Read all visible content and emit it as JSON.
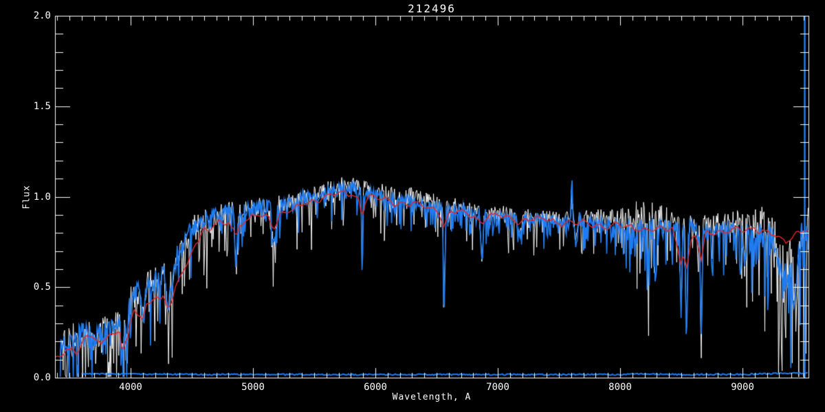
{
  "title": "212496",
  "axes": {
    "x": {
      "label": "Wavelength, A",
      "range": [
        3382,
        9539
      ],
      "major_ticks": [
        4000,
        5000,
        6000,
        7000,
        8000,
        9000
      ],
      "tick_labels": [
        "4000",
        "5000",
        "6000",
        "7000",
        "8000",
        "9000"
      ],
      "minor_tick_interval": 100
    },
    "y": {
      "label": "Flux",
      "range": [
        0,
        2
      ],
      "major_ticks": [
        0.0,
        0.5,
        1.0,
        1.5,
        2.0
      ],
      "tick_labels": [
        "0.0",
        "0.5",
        "1.0",
        "1.5",
        "2.0"
      ],
      "minor_tick_interval": 0.1
    }
  },
  "colors": {
    "background": "#000000",
    "axis": "#ffffff",
    "observed_spectrum_white": "#ffffff",
    "observed_spectrum_blue": "#1f7cf0",
    "model_fit_red": "#e22828"
  },
  "chart_data": {
    "type": "line",
    "title": "212496",
    "xlabel": "Wavelength, A",
    "ylabel": "Flux",
    "xlim": [
      3382,
      9539
    ],
    "ylim": [
      0,
      2
    ],
    "grid": false,
    "legend": "none",
    "start_wavelength_observed": 3425,
    "start_wavelength_error": 3600,
    "error_level": 0.013,
    "edge_line_wavelength": 9506,
    "continuum": [
      [
        3390,
        0.17
      ],
      [
        3500,
        0.21
      ],
      [
        3600,
        0.24
      ],
      [
        3700,
        0.22
      ],
      [
        3800,
        0.26
      ],
      [
        3900,
        0.3
      ],
      [
        4000,
        0.44
      ],
      [
        4100,
        0.5
      ],
      [
        4200,
        0.54
      ],
      [
        4300,
        0.6
      ],
      [
        4400,
        0.7
      ],
      [
        4500,
        0.84
      ],
      [
        4600,
        0.88
      ],
      [
        4700,
        0.9
      ],
      [
        4800,
        0.92
      ],
      [
        4900,
        0.92
      ],
      [
        5000,
        0.93
      ],
      [
        5100,
        0.95
      ],
      [
        5200,
        0.95
      ],
      [
        5300,
        0.96
      ],
      [
        5400,
        0.99
      ],
      [
        5500,
        1.01
      ],
      [
        5600,
        1.02
      ],
      [
        5700,
        1.04
      ],
      [
        5800,
        1.05
      ],
      [
        5900,
        1.03
      ],
      [
        6000,
        1.01
      ],
      [
        6100,
        1.0
      ],
      [
        6200,
        0.99
      ],
      [
        6300,
        0.98
      ],
      [
        6400,
        0.96
      ],
      [
        6500,
        0.95
      ],
      [
        6600,
        0.94
      ],
      [
        6700,
        0.93
      ],
      [
        6800,
        0.92
      ],
      [
        6900,
        0.91
      ],
      [
        7000,
        0.9
      ],
      [
        7100,
        0.9
      ],
      [
        7200,
        0.89
      ],
      [
        7300,
        0.88
      ],
      [
        7400,
        0.88
      ],
      [
        7500,
        0.87
      ],
      [
        7600,
        0.87
      ],
      [
        7700,
        0.86
      ],
      [
        7800,
        0.86
      ],
      [
        7900,
        0.85
      ],
      [
        8000,
        0.85
      ],
      [
        8100,
        0.83
      ],
      [
        8200,
        0.82
      ],
      [
        8300,
        0.82
      ],
      [
        8400,
        0.83
      ],
      [
        8500,
        0.83
      ],
      [
        8600,
        0.83
      ],
      [
        8700,
        0.82
      ],
      [
        8800,
        0.82
      ],
      [
        8900,
        0.81
      ],
      [
        9000,
        0.81
      ],
      [
        9100,
        0.8
      ],
      [
        9200,
        0.8
      ],
      [
        9300,
        0.79
      ],
      [
        9400,
        0.79
      ],
      [
        9500,
        0.8
      ],
      [
        9539,
        0.8
      ]
    ],
    "features": [
      [
        3934,
        0.22,
        12
      ],
      [
        3969,
        0.18,
        10
      ],
      [
        4102,
        0.18,
        9
      ],
      [
        4305,
        0.22,
        14
      ],
      [
        4340,
        0.15,
        8
      ],
      [
        4861,
        0.3,
        9
      ],
      [
        5175,
        0.22,
        13
      ],
      [
        5892,
        0.44,
        5
      ],
      [
        6563,
        0.48,
        7
      ],
      [
        6870,
        0.28,
        9
      ],
      [
        7180,
        0.1,
        18
      ],
      [
        7605,
        -0.28,
        5
      ],
      [
        7640,
        0.12,
        10
      ],
      [
        8227,
        0.1,
        8
      ],
      [
        8498,
        0.52,
        6
      ],
      [
        8542,
        0.6,
        7
      ],
      [
        8662,
        0.55,
        7
      ],
      [
        8750,
        0.25,
        5
      ],
      [
        9015,
        0.2,
        8
      ],
      [
        9345,
        0.22,
        55
      ],
      [
        9430,
        0.3,
        18
      ]
    ],
    "noise_sigma": [
      [
        3390,
        0.085
      ],
      [
        3600,
        0.085
      ],
      [
        3800,
        0.08
      ],
      [
        4000,
        0.075
      ],
      [
        4200,
        0.07
      ],
      [
        4400,
        0.06
      ],
      [
        4700,
        0.052
      ],
      [
        5000,
        0.05
      ],
      [
        5300,
        0.048
      ],
      [
        5600,
        0.045
      ],
      [
        6000,
        0.042
      ],
      [
        6400,
        0.042
      ],
      [
        6800,
        0.038
      ],
      [
        7200,
        0.032
      ],
      [
        7600,
        0.035
      ],
      [
        8000,
        0.04
      ],
      [
        8120,
        0.075
      ],
      [
        8250,
        0.085
      ],
      [
        8380,
        0.06
      ],
      [
        8500,
        0.05
      ],
      [
        8700,
        0.045
      ],
      [
        8900,
        0.055
      ],
      [
        9050,
        0.07
      ],
      [
        9200,
        0.1
      ],
      [
        9350,
        0.12
      ],
      [
        9450,
        0.13
      ],
      [
        9539,
        0.12
      ]
    ],
    "white_offset": [
      [
        3390,
        0.0
      ],
      [
        4500,
        0.0
      ],
      [
        5000,
        0.005
      ],
      [
        5500,
        0.01
      ],
      [
        5800,
        0.025
      ],
      [
        6200,
        0.03
      ],
      [
        6600,
        0.025
      ],
      [
        7000,
        0.015
      ],
      [
        7400,
        0.01
      ],
      [
        7800,
        0.03
      ],
      [
        8000,
        0.055
      ],
      [
        8200,
        0.075
      ],
      [
        8400,
        0.06
      ],
      [
        8600,
        0.02
      ],
      [
        8800,
        0.045
      ],
      [
        9000,
        0.055
      ],
      [
        9200,
        0.05
      ],
      [
        9350,
        0.04
      ],
      [
        9539,
        0.03
      ]
    ],
    "model": [
      [
        3390,
        0.1
      ],
      [
        3440,
        0.13
      ],
      [
        3470,
        0.16
      ],
      [
        3500,
        0.15
      ],
      [
        3530,
        0.18
      ],
      [
        3560,
        0.14
      ],
      [
        3600,
        0.19
      ],
      [
        3640,
        0.22
      ],
      [
        3680,
        0.24
      ],
      [
        3720,
        0.2
      ],
      [
        3750,
        0.17
      ],
      [
        3790,
        0.22
      ],
      [
        3830,
        0.26
      ],
      [
        3870,
        0.24
      ],
      [
        3910,
        0.26
      ],
      [
        3935,
        0.14
      ],
      [
        3955,
        0.22
      ],
      [
        3970,
        0.17
      ],
      [
        4000,
        0.3
      ],
      [
        4030,
        0.37
      ],
      [
        4060,
        0.35
      ],
      [
        4100,
        0.31
      ],
      [
        4130,
        0.4
      ],
      [
        4170,
        0.44
      ],
      [
        4200,
        0.46
      ],
      [
        4240,
        0.42
      ],
      [
        4270,
        0.46
      ],
      [
        4305,
        0.38
      ],
      [
        4340,
        0.41
      ],
      [
        4370,
        0.5
      ],
      [
        4400,
        0.55
      ],
      [
        4430,
        0.6
      ],
      [
        4470,
        0.64
      ],
      [
        4500,
        0.7
      ],
      [
        4530,
        0.75
      ],
      [
        4570,
        0.79
      ],
      [
        4600,
        0.82
      ],
      [
        4640,
        0.8
      ],
      [
        4680,
        0.84
      ],
      [
        4720,
        0.86
      ],
      [
        4760,
        0.84
      ],
      [
        4800,
        0.87
      ],
      [
        4830,
        0.84
      ],
      [
        4861,
        0.77
      ],
      [
        4890,
        0.85
      ],
      [
        4930,
        0.87
      ],
      [
        4970,
        0.86
      ],
      [
        5000,
        0.89
      ],
      [
        5040,
        0.9
      ],
      [
        5080,
        0.88
      ],
      [
        5120,
        0.89
      ],
      [
        5175,
        0.84
      ],
      [
        5220,
        0.9
      ],
      [
        5260,
        0.92
      ],
      [
        5300,
        0.93
      ],
      [
        5340,
        0.92
      ],
      [
        5380,
        0.95
      ],
      [
        5420,
        0.96
      ],
      [
        5460,
        0.97
      ],
      [
        5500,
        0.98
      ],
      [
        5540,
        0.99
      ],
      [
        5580,
        1.0
      ],
      [
        5620,
        1.0
      ],
      [
        5660,
        1.01
      ],
      [
        5700,
        1.01
      ],
      [
        5740,
        1.02
      ],
      [
        5780,
        1.02
      ],
      [
        5820,
        1.01
      ],
      [
        5860,
        1.0
      ],
      [
        5892,
        0.9
      ],
      [
        5920,
        0.99
      ],
      [
        5960,
        1.0
      ],
      [
        6000,
        0.99
      ],
      [
        6050,
        0.98
      ],
      [
        6100,
        0.98
      ],
      [
        6150,
        0.97
      ],
      [
        6200,
        0.97
      ],
      [
        6250,
        0.96
      ],
      [
        6300,
        0.96
      ],
      [
        6350,
        0.95
      ],
      [
        6400,
        0.94
      ],
      [
        6450,
        0.94
      ],
      [
        6500,
        0.93
      ],
      [
        6530,
        0.91
      ],
      [
        6563,
        0.83
      ],
      [
        6600,
        0.91
      ],
      [
        6650,
        0.92
      ],
      [
        6700,
        0.91
      ],
      [
        6750,
        0.91
      ],
      [
        6800,
        0.9
      ],
      [
        6870,
        0.86
      ],
      [
        6920,
        0.9
      ],
      [
        6970,
        0.89
      ],
      [
        7020,
        0.89
      ],
      [
        7070,
        0.88
      ],
      [
        7120,
        0.88
      ],
      [
        7180,
        0.86
      ],
      [
        7230,
        0.88
      ],
      [
        7280,
        0.88
      ],
      [
        7330,
        0.87
      ],
      [
        7380,
        0.87
      ],
      [
        7430,
        0.87
      ],
      [
        7480,
        0.86
      ],
      [
        7530,
        0.86
      ],
      [
        7580,
        0.86
      ],
      [
        7630,
        0.85
      ],
      [
        7680,
        0.85
      ],
      [
        7730,
        0.85
      ],
      [
        7780,
        0.85
      ],
      [
        7830,
        0.84
      ],
      [
        7880,
        0.84
      ],
      [
        7930,
        0.84
      ],
      [
        7980,
        0.84
      ],
      [
        8030,
        0.83
      ],
      [
        8080,
        0.83
      ],
      [
        8150,
        0.83
      ],
      [
        8220,
        0.82
      ],
      [
        8290,
        0.82
      ],
      [
        8360,
        0.82
      ],
      [
        8430,
        0.82
      ],
      [
        8498,
        0.63
      ],
      [
        8520,
        0.72
      ],
      [
        8542,
        0.6
      ],
      [
        8580,
        0.76
      ],
      [
        8620,
        0.8
      ],
      [
        8662,
        0.63
      ],
      [
        8700,
        0.79
      ],
      [
        8750,
        0.8
      ],
      [
        8800,
        0.81
      ],
      [
        8850,
        0.81
      ],
      [
        8900,
        0.82
      ],
      [
        8950,
        0.82
      ],
      [
        9000,
        0.81
      ],
      [
        9050,
        0.81
      ],
      [
        9100,
        0.82
      ],
      [
        9150,
        0.82
      ],
      [
        9200,
        0.81
      ],
      [
        9250,
        0.8
      ],
      [
        9300,
        0.77
      ],
      [
        9350,
        0.74
      ],
      [
        9400,
        0.77
      ],
      [
        9450,
        0.81
      ],
      [
        9500,
        0.82
      ],
      [
        9539,
        0.82
      ]
    ],
    "series": [
      {
        "name": "observed-spectrum-white",
        "color": "#ffffff"
      },
      {
        "name": "observed-spectrum-blue",
        "color": "#1f7cf0"
      },
      {
        "name": "error-spectrum-blue",
        "color": "#1f7cf0"
      },
      {
        "name": "model-fit-red",
        "color": "#e22828"
      },
      {
        "name": "edge-artifact-line",
        "color": "#1f7cf0"
      }
    ]
  }
}
